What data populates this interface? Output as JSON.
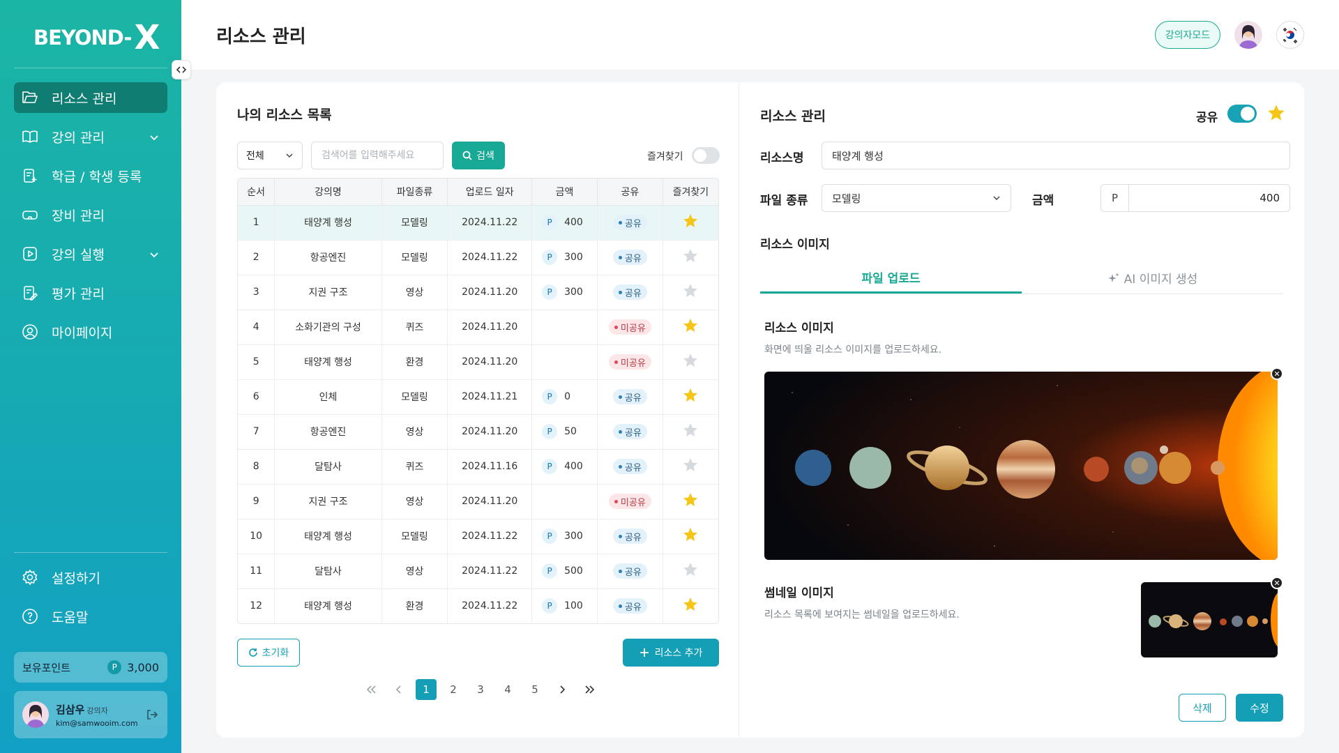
{
  "brand": {
    "logo_text": "BEYOND-",
    "logo_x": "X"
  },
  "sidebar": {
    "items": [
      {
        "label": "리소스 관리",
        "icon": "folder-open-icon",
        "active": true
      },
      {
        "label": "강의 관리",
        "icon": "book-open-icon",
        "has_chevron": true
      },
      {
        "label": "학급 / 학생 등록",
        "icon": "register-icon"
      },
      {
        "label": "장비 관리",
        "icon": "vr-headset-icon"
      },
      {
        "label": "강의 실행",
        "icon": "play-square-icon",
        "has_chevron": true
      },
      {
        "label": "평가 관리",
        "icon": "evaluation-icon"
      },
      {
        "label": "마이페이지",
        "icon": "user-circle-icon"
      }
    ],
    "bottom": [
      {
        "label": "설정하기",
        "icon": "gear-icon"
      },
      {
        "label": "도움말",
        "icon": "help-circle-icon"
      }
    ],
    "points_label": "보유포인트",
    "points_badge": "P",
    "points_value": "3,000",
    "user": {
      "name": "김삼우",
      "role": "강의자",
      "email": "kim@samwooim.com"
    }
  },
  "header": {
    "title": "리소스 관리",
    "mode_button": "강의자모드"
  },
  "list": {
    "title": "나의 리소스 목록",
    "filter_value": "전체",
    "search_placeholder": "검색어를 입력해주세요",
    "search_button": "검색",
    "favorites_toggle_label": "즐겨찾기",
    "columns": [
      "순서",
      "강의명",
      "파일종류",
      "업로드 일자",
      "금액",
      "공유",
      "즐겨찾기"
    ],
    "rows": [
      {
        "no": "1",
        "name": "태양계 행성",
        "type": "모델링",
        "date": "2024.11.22",
        "price": "400",
        "share": "공유",
        "shared": true,
        "fav": true
      },
      {
        "no": "2",
        "name": "항공엔진",
        "type": "모델링",
        "date": "2024.11.22",
        "price": "300",
        "share": "공유",
        "shared": true,
        "fav": false
      },
      {
        "no": "3",
        "name": "지권 구조",
        "type": "영상",
        "date": "2024.11.20",
        "price": "300",
        "share": "공유",
        "shared": true,
        "fav": false
      },
      {
        "no": "4",
        "name": "소화기관의 구성",
        "type": "퀴즈",
        "date": "2024.11.20",
        "price": "",
        "share": "미공유",
        "shared": false,
        "fav": true
      },
      {
        "no": "5",
        "name": "태양계 행성",
        "type": "환경",
        "date": "2024.11.20",
        "price": "",
        "share": "미공유",
        "shared": false,
        "fav": false
      },
      {
        "no": "6",
        "name": "인체",
        "type": "모델링",
        "date": "2024.11.21",
        "price": "0",
        "share": "공유",
        "shared": true,
        "fav": true
      },
      {
        "no": "7",
        "name": "항공엔진",
        "type": "영상",
        "date": "2024.11.20",
        "price": "50",
        "share": "공유",
        "shared": true,
        "fav": false
      },
      {
        "no": "8",
        "name": "달탐사",
        "type": "퀴즈",
        "date": "2024.11.16",
        "price": "400",
        "share": "공유",
        "shared": true,
        "fav": false
      },
      {
        "no": "9",
        "name": "지권 구조",
        "type": "영상",
        "date": "2024.11.20",
        "price": "",
        "share": "미공유",
        "shared": false,
        "fav": true
      },
      {
        "no": "10",
        "name": "태양계 행성",
        "type": "모델링",
        "date": "2024.11.22",
        "price": "300",
        "share": "공유",
        "shared": true,
        "fav": true
      },
      {
        "no": "11",
        "name": "달탐사",
        "type": "영상",
        "date": "2024.11.22",
        "price": "500",
        "share": "공유",
        "shared": true,
        "fav": false
      },
      {
        "no": "12",
        "name": "태양계 행성",
        "type": "환경",
        "date": "2024.11.22",
        "price": "100",
        "share": "공유",
        "shared": true,
        "fav": true
      }
    ],
    "price_badge": "P",
    "reset_button": "초기화",
    "add_button": "리소스 추가",
    "pages": [
      "1",
      "2",
      "3",
      "4",
      "5"
    ],
    "current_page": "1"
  },
  "detail": {
    "title": "리소스 관리",
    "share_label": "공유",
    "share_on": true,
    "favorite": true,
    "name_label": "리소스명",
    "name_value": "태양계 행성",
    "type_label": "파일 종류",
    "type_value": "모델링",
    "price_label": "금액",
    "price_prefix": "P",
    "price_value": "400",
    "image_section_label": "리소스 이미지",
    "tabs": [
      "파일 업로드",
      "AI 이미지 생성"
    ],
    "active_tab": "파일 업로드",
    "resource_image_title": "리소스 이미지",
    "resource_image_desc": "화면에 띄울 리소스 이미지를 업로드하세요.",
    "thumbnail_title": "썸네일 이미지",
    "thumbnail_desc": "리소스 목록에 보여지는 썸네일을 업로드하세요.",
    "delete_button": "삭제",
    "edit_button": "수정"
  },
  "colors": {
    "accent": "#17a995",
    "primary": "#159fb6",
    "star": "#f5c518"
  }
}
